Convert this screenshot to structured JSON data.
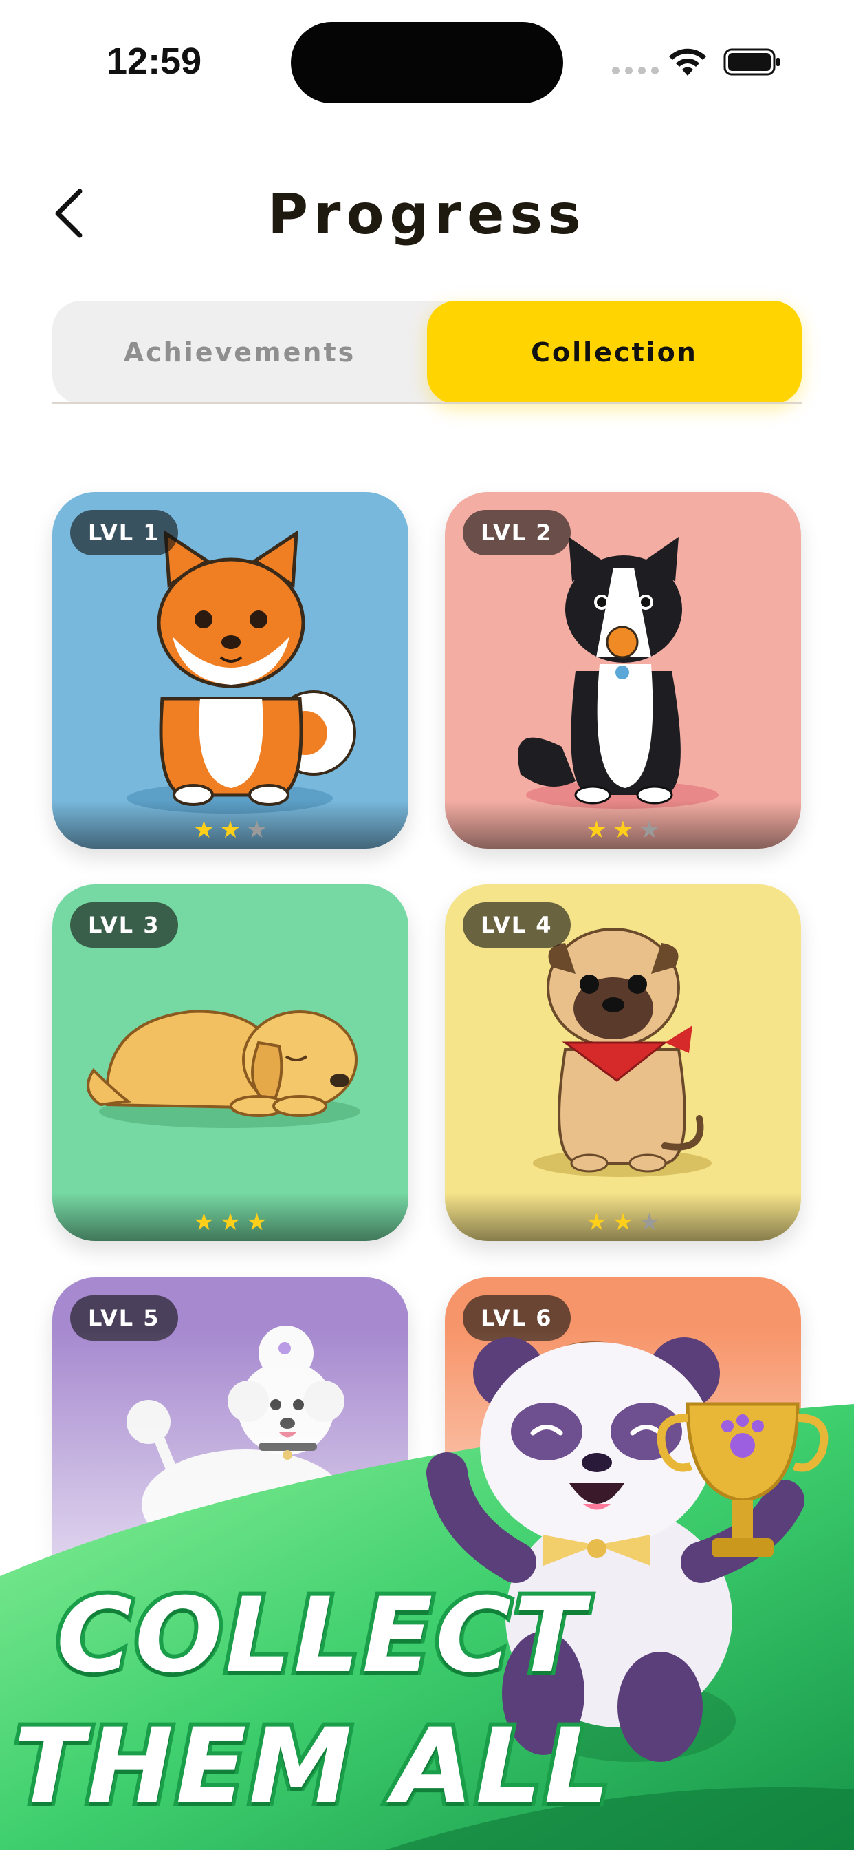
{
  "status_bar": {
    "time": "12:59"
  },
  "header": {
    "title": "Progress"
  },
  "tabs": [
    {
      "label": "Achievements",
      "selected": false
    },
    {
      "label": "Collection",
      "selected": true
    }
  ],
  "cards": [
    {
      "level": "LVL 1",
      "stars": 2,
      "max_stars": 3,
      "color": "#78b8dc"
    },
    {
      "level": "LVL 2",
      "stars": 2,
      "max_stars": 3,
      "color": "#f4ada3"
    },
    {
      "level": "LVL 3",
      "stars": 3,
      "max_stars": 3,
      "color": "#76d9a4"
    },
    {
      "level": "LVL 4",
      "stars": 2,
      "max_stars": 3,
      "color": "#f6e48a"
    },
    {
      "level": "LVL 5",
      "color": "#a689cf"
    },
    {
      "level": "LVL 6",
      "color": "#f7956a"
    }
  ],
  "promo": {
    "line1": "COLLECT",
    "line2": "THEM ALL"
  },
  "colors": {
    "accent": "#ffd400",
    "promo_green": "#1a9e49"
  }
}
